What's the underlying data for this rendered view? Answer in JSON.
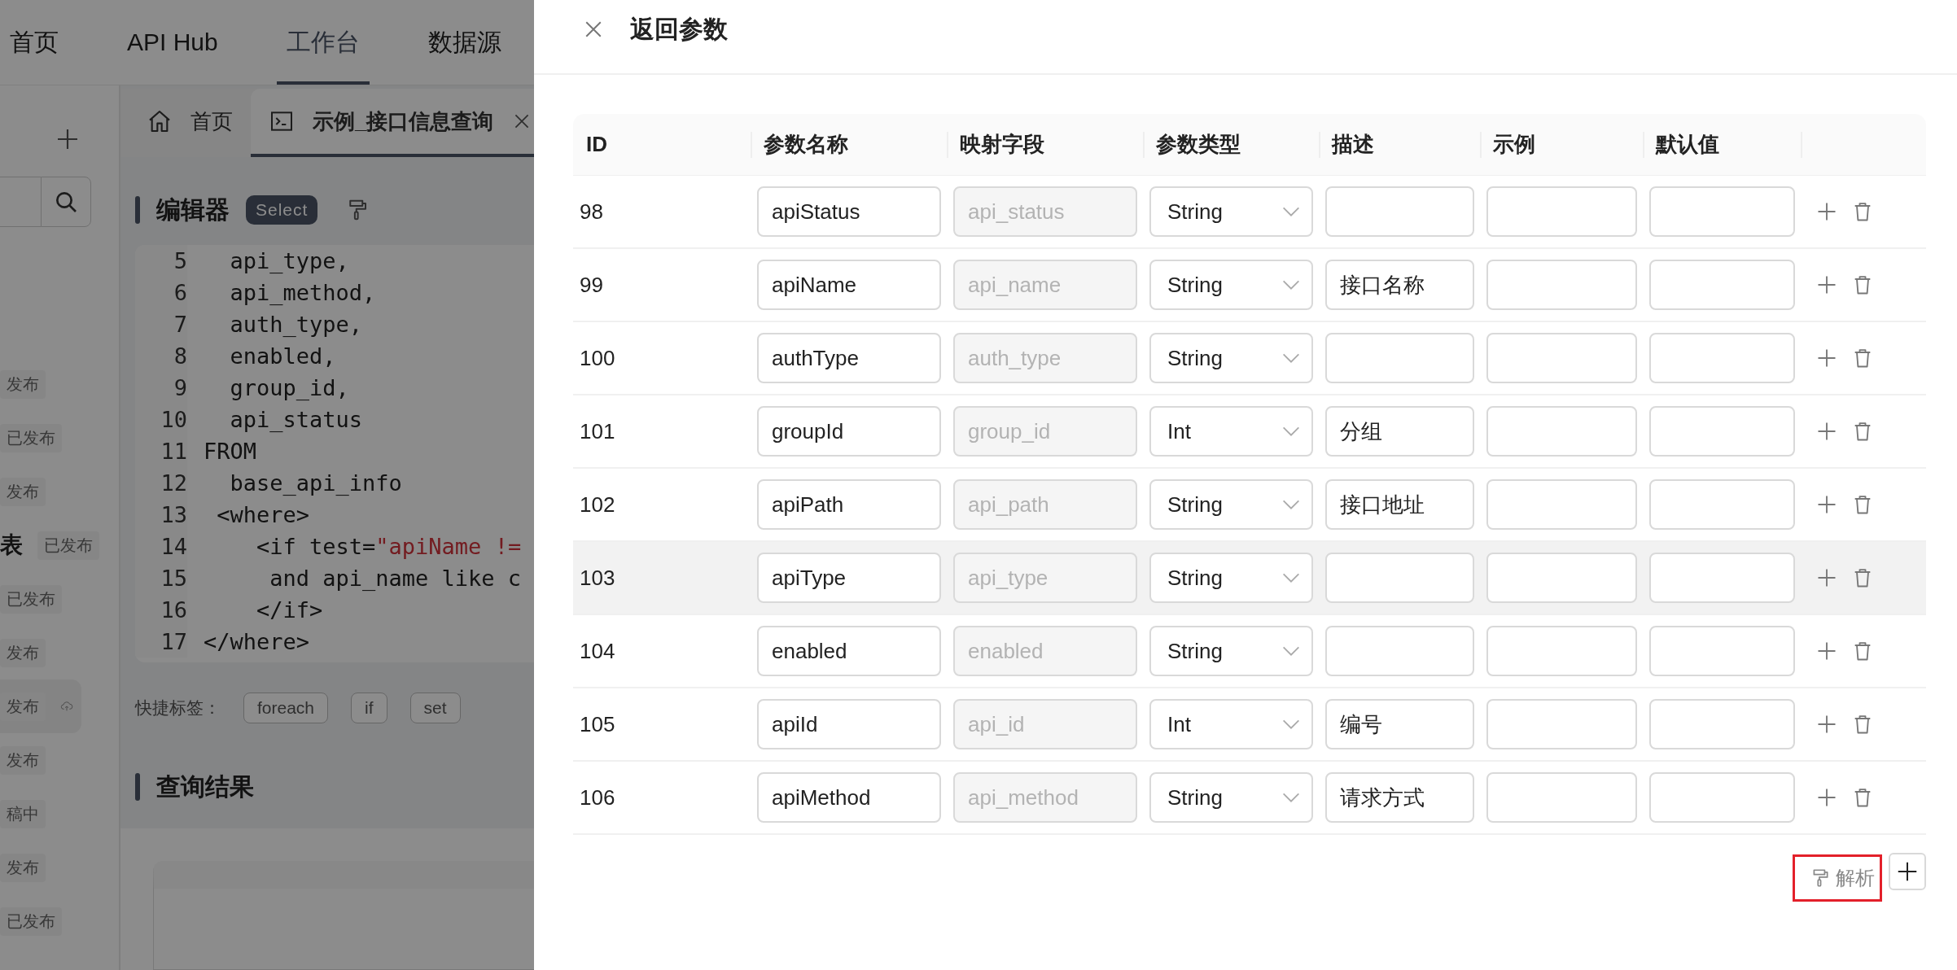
{
  "top_nav": {
    "items": [
      {
        "label": "首页",
        "selected": false
      },
      {
        "label": "API Hub",
        "selected": false
      },
      {
        "label": "工作台",
        "selected": true
      },
      {
        "label": "数据源",
        "selected": false
      }
    ]
  },
  "sidebar": {
    "items": [
      {
        "status": "发布",
        "selected": false
      },
      {
        "status": "已发布",
        "selected": false
      },
      {
        "status": "发布",
        "selected": false
      },
      {
        "name": "表",
        "status": "已发布",
        "selected": false
      },
      {
        "status": "已发布",
        "selected": false
      },
      {
        "status": "发布",
        "selected": false
      },
      {
        "status": "发布",
        "selected": true
      },
      {
        "status": "发布",
        "selected": false
      },
      {
        "status": "稿中",
        "selected": false
      },
      {
        "status": "发布",
        "selected": false
      },
      {
        "status": "已发布",
        "selected": false
      }
    ]
  },
  "tabs": [
    {
      "kind": "home",
      "label": "首页",
      "selected": false
    },
    {
      "kind": "query",
      "label": "示例_接口信息查询",
      "selected": true
    }
  ],
  "editor": {
    "title": "编辑器",
    "mode_badge": "Select",
    "lines": [
      {
        "number": "5",
        "segments": [
          {
            "text": "  api_type,",
            "kind": "plain"
          }
        ]
      },
      {
        "number": "6",
        "segments": [
          {
            "text": "  api_method,",
            "kind": "plain"
          }
        ]
      },
      {
        "number": "7",
        "segments": [
          {
            "text": "  auth_type,",
            "kind": "plain"
          }
        ]
      },
      {
        "number": "8",
        "segments": [
          {
            "text": "  enabled,",
            "kind": "plain"
          }
        ]
      },
      {
        "number": "9",
        "segments": [
          {
            "text": "  group_id,",
            "kind": "plain"
          }
        ]
      },
      {
        "number": "10",
        "segments": [
          {
            "text": "  api_status",
            "kind": "plain"
          }
        ]
      },
      {
        "number": "11",
        "segments": [
          {
            "text": "FROM",
            "kind": "plain"
          }
        ]
      },
      {
        "number": "12",
        "segments": [
          {
            "text": "  base_api_info",
            "kind": "plain"
          }
        ]
      },
      {
        "number": "13",
        "segments": [
          {
            "text": " <where>",
            "kind": "plain"
          }
        ]
      },
      {
        "number": "14",
        "segments": [
          {
            "text": "    <if test=",
            "kind": "plain"
          },
          {
            "text": "\"apiName !=",
            "kind": "string"
          }
        ]
      },
      {
        "number": "15",
        "segments": [
          {
            "text": "     and api_name like c",
            "kind": "plain"
          }
        ]
      },
      {
        "number": "16",
        "segments": [
          {
            "text": "    </if>",
            "kind": "plain"
          }
        ]
      },
      {
        "number": "17",
        "segments": [
          {
            "text": "</where>",
            "kind": "plain"
          }
        ]
      }
    ]
  },
  "quick_tags": {
    "label": "快捷标签：",
    "tags": [
      "foreach",
      "if",
      "set"
    ]
  },
  "results": {
    "title": "查询结果"
  },
  "drawer": {
    "title": "返回参数",
    "columns": [
      "ID",
      "参数名称",
      "映射字段",
      "参数类型",
      "描述",
      "示例",
      "默认值"
    ],
    "rows": [
      {
        "id": "98",
        "name": "apiStatus",
        "mapping": "api_status",
        "mapping_disabled": true,
        "type": "String",
        "highlighted": false
      },
      {
        "id": "99",
        "name": "apiName",
        "mapping": "api_name",
        "mapping_disabled": true,
        "type": "String",
        "description": "接口名称",
        "highlighted": false
      },
      {
        "id": "100",
        "name": "authType",
        "mapping": "auth_type",
        "mapping_disabled": true,
        "type": "String",
        "highlighted": false
      },
      {
        "id": "101",
        "name": "groupId",
        "mapping": "group_id",
        "mapping_disabled": true,
        "type": "Int",
        "description": "分组",
        "highlighted": false
      },
      {
        "id": "102",
        "name": "apiPath",
        "mapping": "api_path",
        "mapping_disabled": true,
        "type": "String",
        "description": "接口地址",
        "highlighted": false
      },
      {
        "id": "103",
        "name": "apiType",
        "mapping": "api_type",
        "mapping_disabled": true,
        "type": "String",
        "highlighted": true
      },
      {
        "id": "104",
        "name": "enabled",
        "mapping": "enabled",
        "mapping_disabled": true,
        "type": "String",
        "highlighted": false
      },
      {
        "id": "105",
        "name": "apiId",
        "mapping": "api_id",
        "mapping_disabled": true,
        "type": "Int",
        "description": "编号",
        "highlighted": false
      },
      {
        "id": "106",
        "name": "apiMethod",
        "mapping": "api_method",
        "mapping_disabled": true,
        "type": "String",
        "description": "请求方式",
        "highlighted": false
      }
    ],
    "parse_button": {
      "label": "解析",
      "highlighted": true
    }
  }
}
